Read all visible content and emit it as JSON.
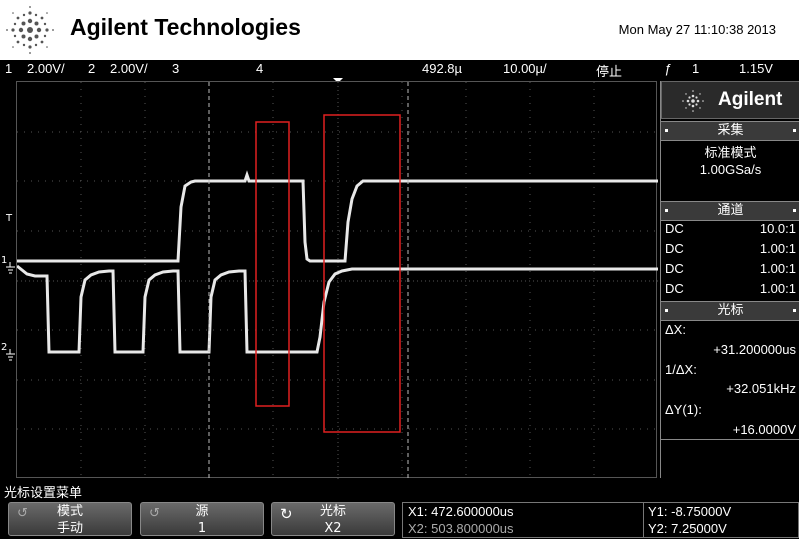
{
  "header": {
    "brand": "Agilent Technologies",
    "datetime": "Mon May 27 11:10:38 2013"
  },
  "status": {
    "ch1_num": "1",
    "ch1_scale": "2.00V/",
    "ch2_num": "2",
    "ch2_scale": "2.00V/",
    "ch3_num": "3",
    "ch4_num": "4",
    "time_pos": "492.8µ",
    "time_base": "10.00µ/",
    "run_state": "停止",
    "trig_symbol": "ƒ",
    "trig_source": "1",
    "trig_level": "1.15V"
  },
  "screen": {
    "trig_marker": "T",
    "ch1_marker": "1",
    "ch2_marker": "2"
  },
  "panel": {
    "brand": "Agilent",
    "acquire_title": "采集",
    "acquire_mode": "标准模式",
    "sample_rate": "1.00GSa/s",
    "channels_title": "通道",
    "channels": [
      {
        "coupling": "DC",
        "probe": "10.0:1"
      },
      {
        "coupling": "DC",
        "probe": "1.00:1"
      },
      {
        "coupling": "DC",
        "probe": "1.00:1"
      },
      {
        "coupling": "DC",
        "probe": "1.00:1"
      }
    ],
    "cursors_title": "光标",
    "dx_label": "ΔX:",
    "dx_value": "+31.200000us",
    "inv_dx_label": "1/ΔX:",
    "inv_dx_value": "+32.051kHz",
    "dy_label": "ΔY(1):",
    "dy_value": "+16.0000V"
  },
  "menu": {
    "title": "光标设置菜单",
    "keys": [
      {
        "label": "模式",
        "value": "手动"
      },
      {
        "label": "源",
        "value": "1"
      },
      {
        "label": "光标",
        "value": "X2"
      }
    ],
    "x1": "X1: 472.600000us",
    "x2": "X2: 503.800000us",
    "y1": "Y1: -8.75000V",
    "y2": "Y2: 7.25000V"
  },
  "colors": {
    "trace": "#e8e8e8",
    "annotation": "#e02020",
    "grid": "#555555"
  }
}
